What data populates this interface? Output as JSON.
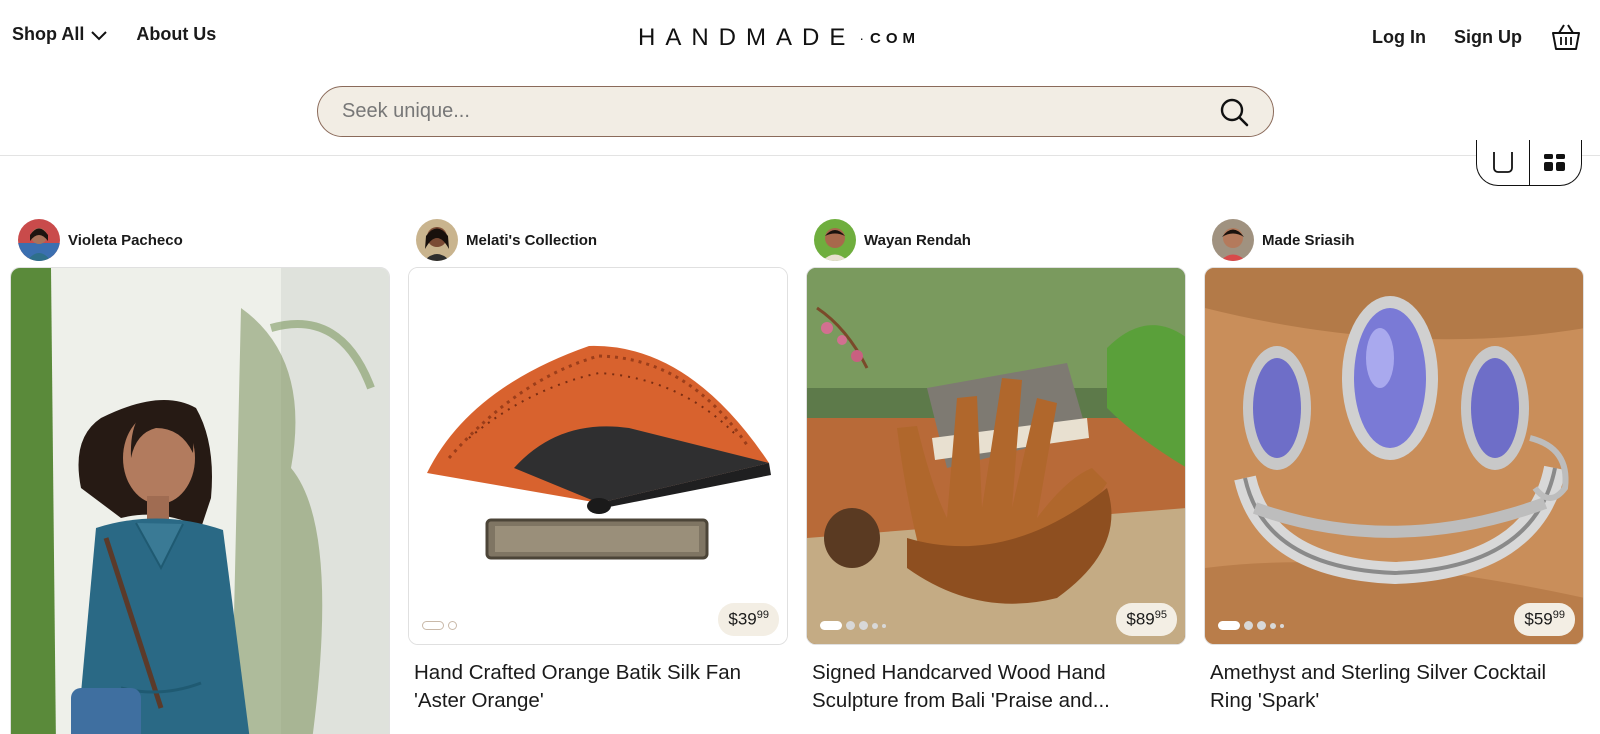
{
  "header": {
    "shop_all": "Shop All",
    "about_us": "About Us",
    "logo_main": "HANDMADE",
    "logo_dot": "·",
    "logo_suffix": "COM",
    "log_in": "Log In",
    "sign_up": "Sign Up"
  },
  "search": {
    "placeholder": "Seek unique..."
  },
  "view_toggle": {
    "options": [
      "single-view-icon",
      "grid-view-icon"
    ],
    "active": "grid"
  },
  "cards": [
    {
      "seller": "Violeta Pacheco",
      "title": "",
      "price_dollars": "",
      "price_cents": ""
    },
    {
      "seller": "Melati's Collection",
      "title": "Hand Crafted Orange Batik Silk Fan 'Aster Orange'",
      "price_dollars": "$39",
      "price_cents": "99",
      "image_count": 2
    },
    {
      "seller": "Wayan Rendah",
      "title": "Signed Handcarved Wood Hand Sculpture from Bali 'Praise and...",
      "price_dollars": "$89",
      "price_cents": "95",
      "image_count": 5
    },
    {
      "seller": "Made Sriasih",
      "title": "Amethyst and Sterling Silver Cocktail Ring 'Spark'",
      "price_dollars": "$59",
      "price_cents": "99",
      "image_count": 5
    }
  ],
  "colors": {
    "search_bg": "#f2ede4",
    "search_border": "#8a6a5a",
    "price_bg": "#f3eee4"
  }
}
